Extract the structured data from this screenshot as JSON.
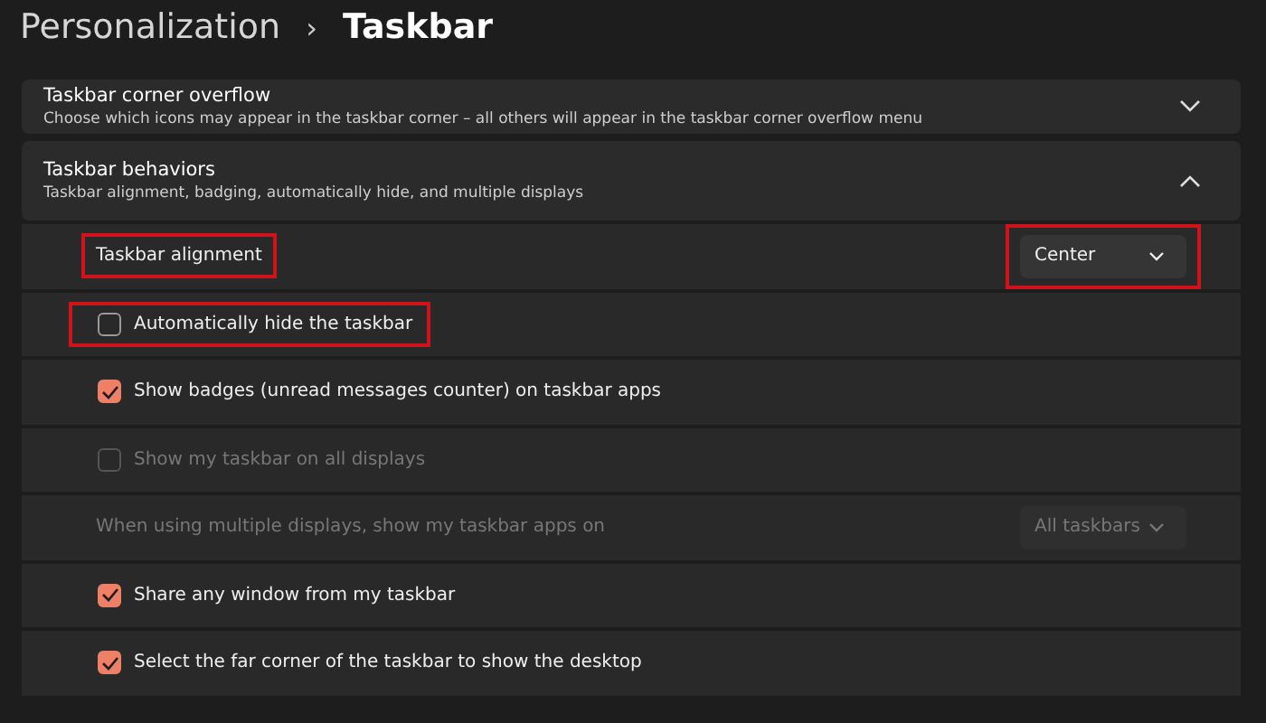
{
  "breadcrumb": {
    "parent": "Personalization",
    "separator": "›",
    "current": "Taskbar"
  },
  "sections": [
    {
      "title": "Taskbar corner overflow",
      "description": "Choose which icons may appear in the taskbar corner – all others will appear in the taskbar corner overflow menu",
      "expanded": false
    },
    {
      "title": "Taskbar behaviors",
      "description": "Taskbar alignment, badging, automatically hide, and multiple displays",
      "expanded": true,
      "rows": [
        {
          "kind": "dropdown",
          "label": "Taskbar alignment",
          "value": "Center",
          "disabled": false,
          "highlighted": true
        },
        {
          "kind": "checkbox",
          "label": "Automatically hide the taskbar",
          "checked": false,
          "disabled": false,
          "highlighted": true
        },
        {
          "kind": "checkbox",
          "label": "Show badges (unread messages counter) on taskbar apps",
          "checked": true,
          "disabled": false,
          "highlighted": false
        },
        {
          "kind": "checkbox",
          "label": "Show my taskbar on all displays",
          "checked": false,
          "disabled": true,
          "highlighted": false
        },
        {
          "kind": "dropdown",
          "label": "When using multiple displays, show my taskbar apps on",
          "value": "All taskbars",
          "disabled": true,
          "highlighted": false
        },
        {
          "kind": "checkbox",
          "label": "Share any window from my taskbar",
          "checked": true,
          "disabled": false,
          "highlighted": false
        },
        {
          "kind": "checkbox",
          "label": "Select the far corner of the taskbar to show the desktop",
          "checked": true,
          "disabled": false,
          "highlighted": false
        }
      ]
    }
  ]
}
